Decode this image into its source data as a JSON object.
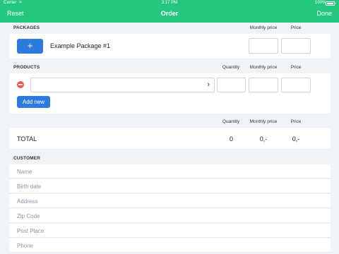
{
  "status_bar": {
    "carrier": "Carrier",
    "wifi_icon": "wifi-icon",
    "time": "3:17 PM",
    "battery": "100%"
  },
  "nav": {
    "left": "Reset",
    "title": "Order",
    "right": "Done"
  },
  "packages": {
    "section_label": "PACKAGES",
    "col_monthly": "Monthly price",
    "col_price": "Price",
    "add_icon": "+",
    "item_name": "Example Package #1"
  },
  "products": {
    "section_label": "PRODUCTS",
    "col_quantity": "Quantity",
    "col_monthly": "Monthly price",
    "col_price": "Price",
    "chevron": "›",
    "add_new": "Add new"
  },
  "totals": {
    "col_quantity": "Quantity",
    "col_monthly": "Monthly price",
    "col_price": "Price",
    "label": "TOTAL",
    "quantity": "0",
    "monthly": "0,-",
    "price": "0,-"
  },
  "customer": {
    "section_label": "CUSTOMER",
    "fields": [
      "Name",
      "Birth date",
      "Address",
      "Zip Code",
      "Post Place",
      "Phone"
    ]
  },
  "colors": {
    "accent": "#25c77f",
    "button": "#2e7be0",
    "remove": "#f2544f",
    "background": "#f0f4f9"
  }
}
